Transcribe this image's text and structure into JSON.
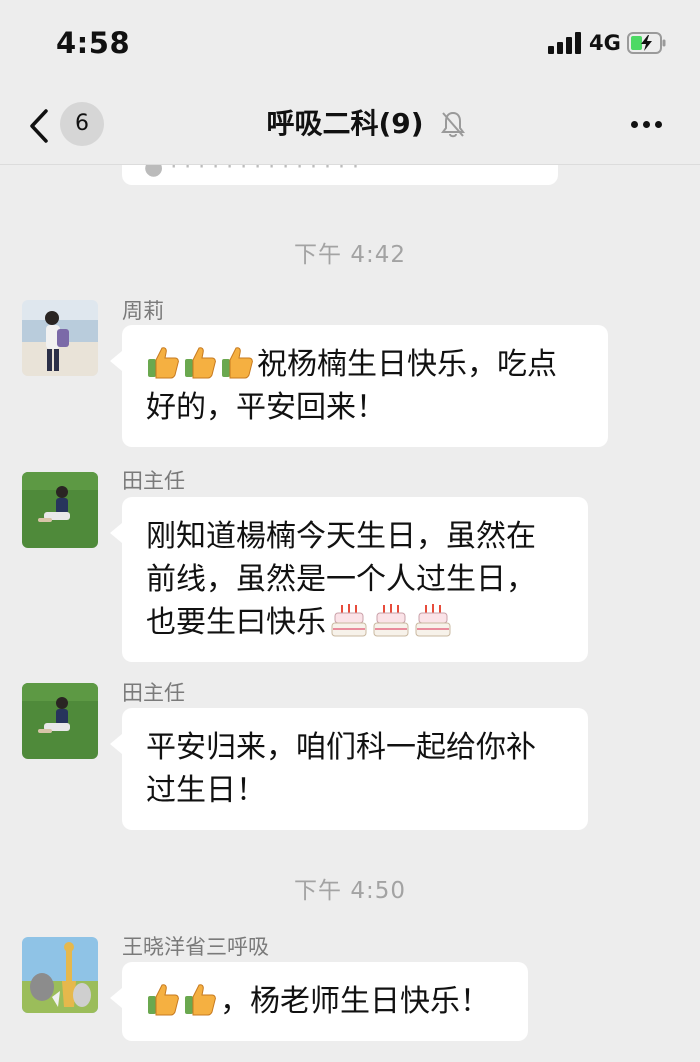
{
  "status_bar": {
    "time": "4:58",
    "network": "4G"
  },
  "nav": {
    "unread_count": "6",
    "title": "呼吸二科(9)"
  },
  "icons": {
    "back": "chevron-left-icon",
    "mute": "bell-slash-icon",
    "more": "more-dots-icon",
    "thumbs_up": "thumbs-up-emoji",
    "cake": "birthday-cake-emoji"
  },
  "timestamps": [
    "下午 4:42",
    "下午 4:50"
  ],
  "messages": [
    {
      "sender": "周莉",
      "lines": [
        "祝杨楠生日快乐，吃点",
        "好的，平安回来！"
      ],
      "leading_emoji": [
        "thumbs-up",
        "thumbs-up",
        "thumbs-up"
      ]
    },
    {
      "sender": "田主任",
      "lines": [
        "刚知道楊楠今天生日，虽然在",
        "前线，虽然是一个人过生日，",
        "也要生曰快乐"
      ],
      "trailing_emoji": [
        "birthday-cake",
        "birthday-cake",
        "birthday-cake"
      ]
    },
    {
      "sender": "田主任",
      "lines": [
        "平安归来，咱们科一起给你补",
        "过生日！"
      ]
    },
    {
      "sender": "王晓洋省三呼吸",
      "lines": [
        "，杨老师生日快乐！"
      ],
      "leading_emoji": [
        "thumbs-up",
        "thumbs-up"
      ]
    }
  ],
  "colors": {
    "background": "#ededed",
    "bubble": "#ffffff",
    "battery_green": "#4cd964"
  }
}
